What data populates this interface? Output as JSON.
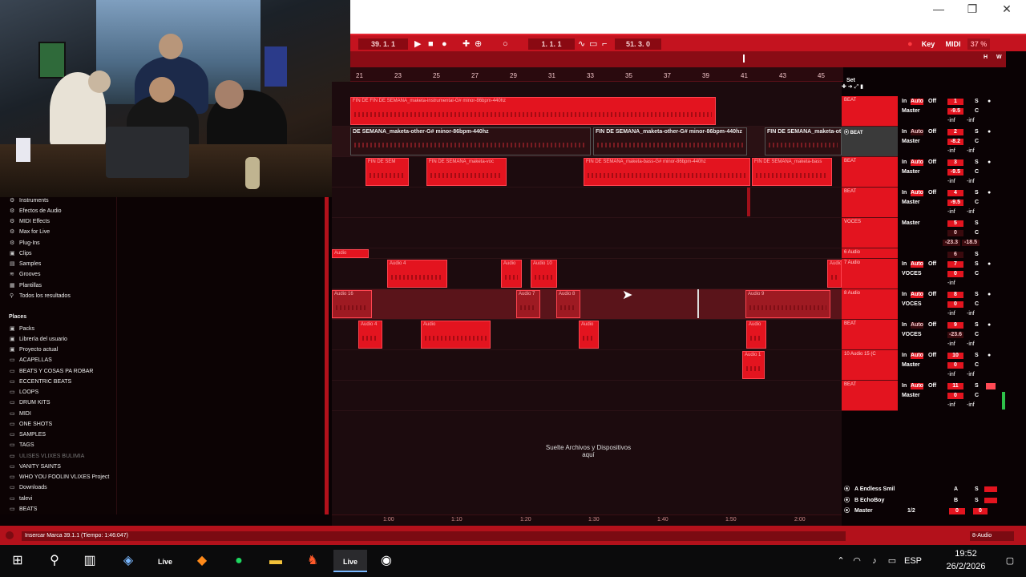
{
  "titlebar": {
    "minimize": "—",
    "restore": "❐",
    "close": "✕"
  },
  "control": {
    "song_position": "39.  1.  1",
    "loop_start": "1.  1.  1",
    "loop_length": "51.  3.  0",
    "key_label": "Key",
    "midi_label": "MIDI",
    "cpu": "37 %"
  },
  "overview": {
    "h": "H",
    "w": "W"
  },
  "ruler": {
    "bars": [
      "21",
      "23",
      "25",
      "27",
      "29",
      "31",
      "33",
      "35",
      "37",
      "39",
      "41",
      "43",
      "45"
    ]
  },
  "set_label": "Set",
  "tracks": [
    {
      "name": "BEAT",
      "clips": [
        {
          "label": "FIN DE FIN DE SEMANA_maketa-instrumental-G# minor-86bpm-440hz"
        }
      ]
    },
    {
      "name": "BEAT",
      "selected": true,
      "clips": [
        {
          "label": "DE SEMANA_maketa-other-G# minor-86bpm-440hz"
        },
        {
          "label": "FIN DE SEMANA_maketa-other-G# minor-86bpm-440hz"
        },
        {
          "label": "FIN DE SEMANA_maketa-ot"
        }
      ]
    },
    {
      "name": "BEAT",
      "clips": [
        {
          "label": "FIN DE SEM"
        },
        {
          "label": "FIN DE SEMANA_maketa-voc"
        },
        {
          "label": "FIN DE SEMANA_maketa-bass-G# minor-86bpm-440hz"
        },
        {
          "label": "FIN DE SEMANA_maketa-bass"
        }
      ]
    },
    {
      "name": "BEAT",
      "clips": []
    },
    {
      "name": "VOCES",
      "clips": []
    },
    {
      "name": "6 Audio",
      "clips": [
        {
          "label": "Audio"
        }
      ]
    },
    {
      "name": "7 Audio",
      "clips": [
        {
          "label": "Audio 4"
        },
        {
          "label": "Audio"
        },
        {
          "label": "Audio 10"
        },
        {
          "label": "Audio"
        }
      ]
    },
    {
      "name": "8 Audio",
      "clips": [
        {
          "label": "Audio 16"
        },
        {
          "label": "Audio 7"
        },
        {
          "label": "Audio 8"
        },
        {
          "label": "Audio 9"
        }
      ]
    },
    {
      "name": "BEAT",
      "clips": [
        {
          "label": "Audio 4"
        },
        {
          "label": "Audio"
        },
        {
          "label": "Audio"
        },
        {
          "label": "Audio"
        }
      ]
    },
    {
      "name": "10 Audio 15 (C",
      "clips": [
        {
          "label": "Audio 1"
        }
      ]
    },
    {
      "name": "BEAT",
      "clips": []
    }
  ],
  "mixer": [
    {
      "in": "In",
      "auto": "Auto",
      "off": "Off",
      "route": "Master",
      "num": "1",
      "vol": "-9.5",
      "s": "S",
      "c": "C",
      "inf1": "-inf",
      "inf2": "-inf"
    },
    {
      "in": "In",
      "auto": "Auto",
      "off": "Off",
      "route": "Master",
      "num": "2",
      "vol": "-8.2",
      "s": "S",
      "c": "C",
      "inf1": "-inf",
      "inf2": "-inf"
    },
    {
      "in": "In",
      "auto": "Auto",
      "off": "Off",
      "route": "Master",
      "num": "3",
      "vol": "-9.5",
      "s": "S",
      "c": "C",
      "inf1": "-inf",
      "inf2": "-inf"
    },
    {
      "in": "In",
      "auto": "Auto",
      "off": "Off",
      "route": "Master",
      "num": "4",
      "vol": "-9.5",
      "s": "S",
      "c": "C",
      "inf1": "-inf",
      "inf2": "-inf"
    },
    {
      "in": "",
      "auto": "",
      "off": "",
      "route": "Master",
      "num": "5",
      "vol": "0",
      "s": "S",
      "c": "C",
      "inf1": "-23.3",
      "inf2": "-18.5"
    },
    {
      "in": "",
      "auto": "",
      "off": "",
      "route": "",
      "num": "6",
      "vol": "",
      "s": "S",
      "c": "",
      "inf1": "",
      "inf2": ""
    },
    {
      "in": "In",
      "auto": "Auto",
      "off": "Off",
      "route": "VOCES",
      "num": "7",
      "vol": "0",
      "s": "S",
      "c": "C",
      "inf1": "-inf",
      "inf2": ""
    },
    {
      "in": "In",
      "auto": "Auto",
      "off": "Off",
      "route": "VOCES",
      "num": "8",
      "vol": "0",
      "s": "S",
      "c": "C",
      "inf1": "-inf",
      "inf2": "-inf"
    },
    {
      "in": "In",
      "auto": "Auto",
      "off": "Off",
      "route": "VOCES",
      "num": "9",
      "vol": "-23.6",
      "s": "S",
      "c": "C",
      "inf1": "-inf",
      "inf2": "-inf"
    },
    {
      "in": "In",
      "auto": "Auto",
      "off": "Off",
      "route": "Master",
      "num": "10",
      "vol": "0",
      "s": "S",
      "c": "C",
      "inf1": "-inf",
      "inf2": "-inf"
    },
    {
      "in": "In",
      "auto": "Auto",
      "off": "Off",
      "route": "Master",
      "num": "11",
      "vol": "0",
      "s": "S",
      "c": "C",
      "inf1": "-inf",
      "inf2": "-inf"
    }
  ],
  "returns": [
    {
      "name": "A Endless Smil",
      "letter": "A",
      "s": "S"
    },
    {
      "name": "B EchoBoy",
      "letter": "B",
      "s": "S"
    },
    {
      "name": "Master",
      "letter": "1/2",
      "s": "0",
      "v": "0"
    }
  ],
  "drop_text": "Suelte Archivos y Dispositivos aquí",
  "browser": {
    "categories": [
      "Instruments",
      "Efectos de Audio",
      "MIDI Effects",
      "Max for Live",
      "Plug-Ins",
      "Clips",
      "Samples",
      "Grooves",
      "Plantillas",
      "Todos los resultados"
    ],
    "places_header": "Places",
    "places": [
      "Packs",
      "Librería del usuario",
      "Proyecto actual",
      "ACAPELLAS",
      "BEATS Y COSAS PA ROBAR",
      "ECCENTRIC BEATS",
      "LOOPS",
      "DRUM KITS",
      "MIDI",
      "ONE SHOTS",
      "SAMPLES",
      "TAGS",
      "ULISES VLIXES BULIMIA",
      "VANITY SAINTS",
      "WHO YOU FOOLIN VLIXES Project",
      "Downloads",
      "talevi",
      "BEATS"
    ]
  },
  "timeline": [
    "1:00",
    "1:10",
    "1:20",
    "1:30",
    "1:40",
    "1:50",
    "2:00"
  ],
  "status": {
    "text": "Insercar Marca 39.1.1 (Tiempo: 1:46:047)",
    "track": "8-Audio"
  },
  "taskbar": {
    "live1": "Live",
    "live2": "Live",
    "lang": "ESP",
    "time": "19:52",
    "date": "26/2/2026"
  }
}
